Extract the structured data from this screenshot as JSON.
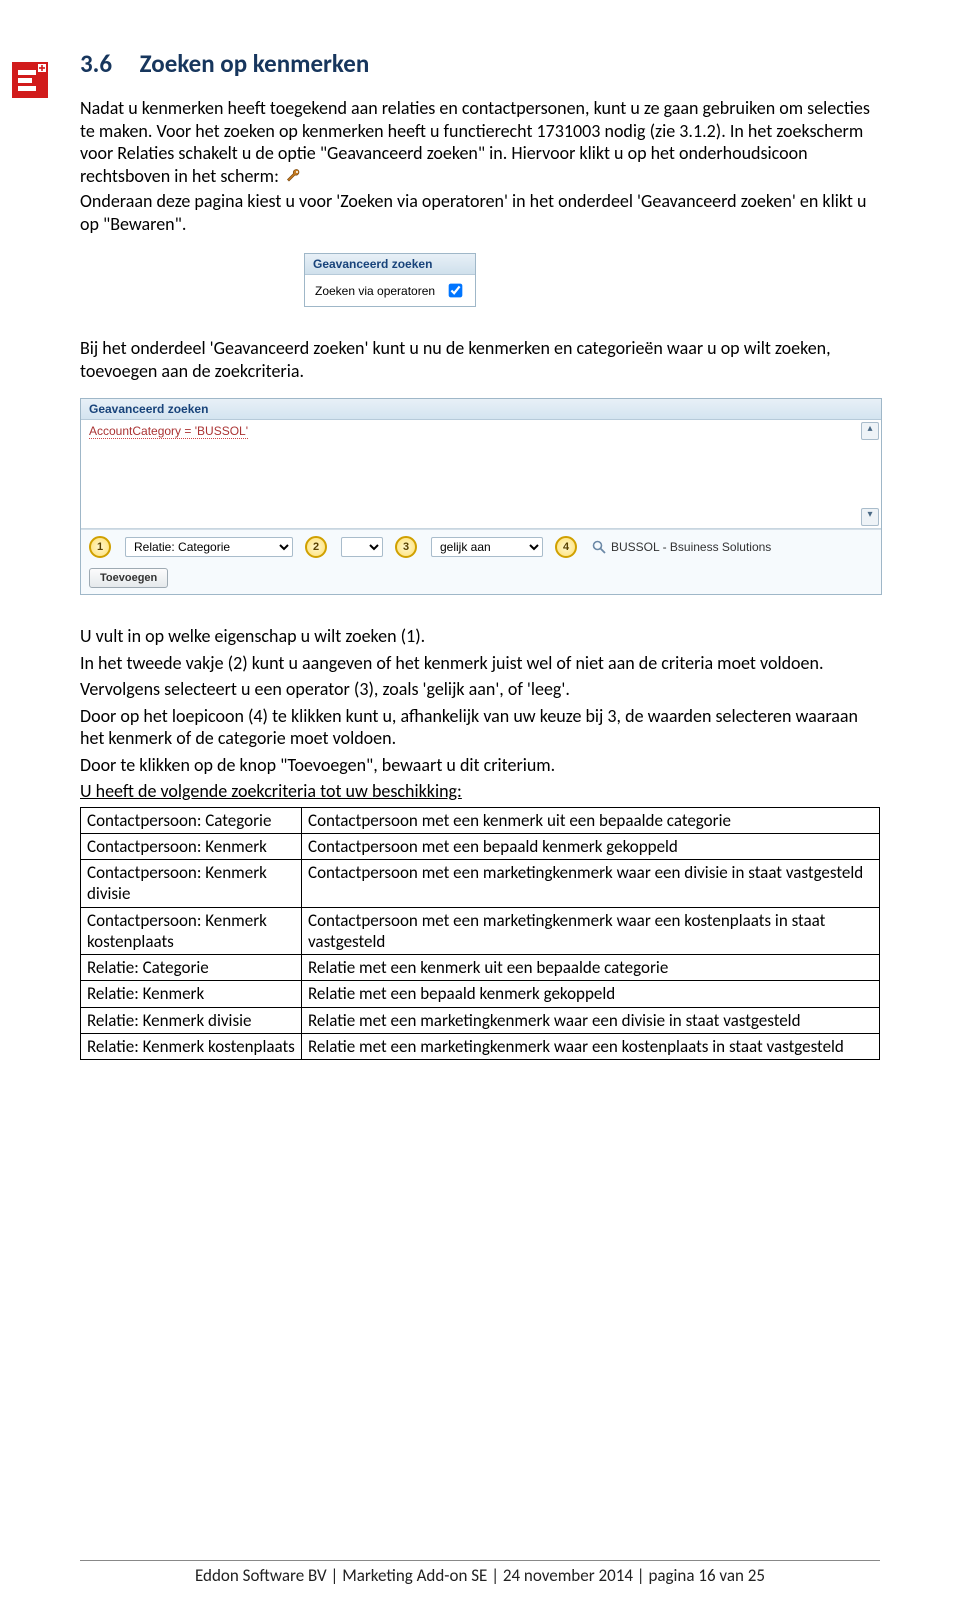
{
  "logo": {
    "alt": "Eddon logo"
  },
  "heading": {
    "number": "3.6",
    "title": "Zoeken op kenmerken"
  },
  "paragraph1": [
    "Nadat u kenmerken heeft toegekend aan relaties en contactpersonen, kunt u ze gaan gebruiken om selecties te maken. Voor het zoeken op kenmerken heeft u functierecht 1731003 nodig (zie 3.1.2). In het zoekscherm voor Relaties schakelt u de optie \"Geavanceerd zoeken\" in. Hiervoor klikt u op het onderhoudsicoon rechtsboven in het scherm: ",
    "Onderaan deze pagina kiest u voor 'Zoeken via operatoren' in het onderdeel 'Geavanceerd zoeken' en klikt u op \"Bewaren\"."
  ],
  "panel1": {
    "header": "Geavanceerd zoeken",
    "label": "Zoeken via operatoren",
    "checked": true
  },
  "paragraph2": "Bij het onderdeel 'Geavanceerd zoeken' kunt u nu de kenmerken en categorieën waar u op wilt zoeken, toevoegen aan de zoekcriteria.",
  "panel2": {
    "header": "Geavanceerd zoeken",
    "formulaText": "AccountCategory = 'BUSSOL'",
    "markers": [
      "1",
      "2",
      "3",
      "4"
    ],
    "select1": "Relatie: Categorie",
    "select2": "gelijk aan",
    "lookupText": "BUSSOL - Bsuiness Solutions",
    "addButton": "Toevoegen"
  },
  "paragraph3": [
    "U vult in op welke eigenschap u wilt zoeken (1).",
    "In het tweede vakje (2) kunt u aangeven of het kenmerk juist wel of niet aan de criteria moet voldoen.",
    "Vervolgens selecteert u een operator (3), zoals 'gelijk aan', of 'leeg'.",
    "Door op het loepicoon (4) te klikken kunt u, afhankelijk van uw keuze bij 3, de waarden selecteren waaraan het kenmerk of de categorie moet voldoen.",
    "Door te klikken op de knop \"Toevoegen\", bewaart u dit criterium."
  ],
  "criteriaLabel": "U heeft de volgende zoekcriteria tot uw beschikking:",
  "criteria": [
    {
      "c1": "Contactpersoon: Categorie",
      "c2": "Contactpersoon met een kenmerk uit een bepaalde categorie"
    },
    {
      "c1": "Contactpersoon: Kenmerk",
      "c2": "Contactpersoon met een bepaald kenmerk gekoppeld"
    },
    {
      "c1": "Contactpersoon: Kenmerk divisie",
      "c2": "Contactpersoon met een marketingkenmerk waar een divisie in staat vastgesteld"
    },
    {
      "c1": "Contactpersoon: Kenmerk kostenplaats",
      "c2": "Contactpersoon met een marketingkenmerk waar een kostenplaats in staat vastgesteld"
    },
    {
      "c1": "Relatie: Categorie",
      "c2": "Relatie met een kenmerk uit een bepaalde categorie"
    },
    {
      "c1": "Relatie: Kenmerk",
      "c2": "Relatie met een bepaald kenmerk gekoppeld"
    },
    {
      "c1": "Relatie: Kenmerk divisie",
      "c2": "Relatie met een marketingkenmerk waar een divisie in staat vastgesteld"
    },
    {
      "c1": "Relatie: Kenmerk kostenplaats",
      "c2": "Relatie met een marketingkenmerk waar een kostenplaats in staat vastgesteld"
    }
  ],
  "footer": "Eddon Software BV | Marketing Add-on SE | 24 november 2014 | pagina 16 van 25"
}
